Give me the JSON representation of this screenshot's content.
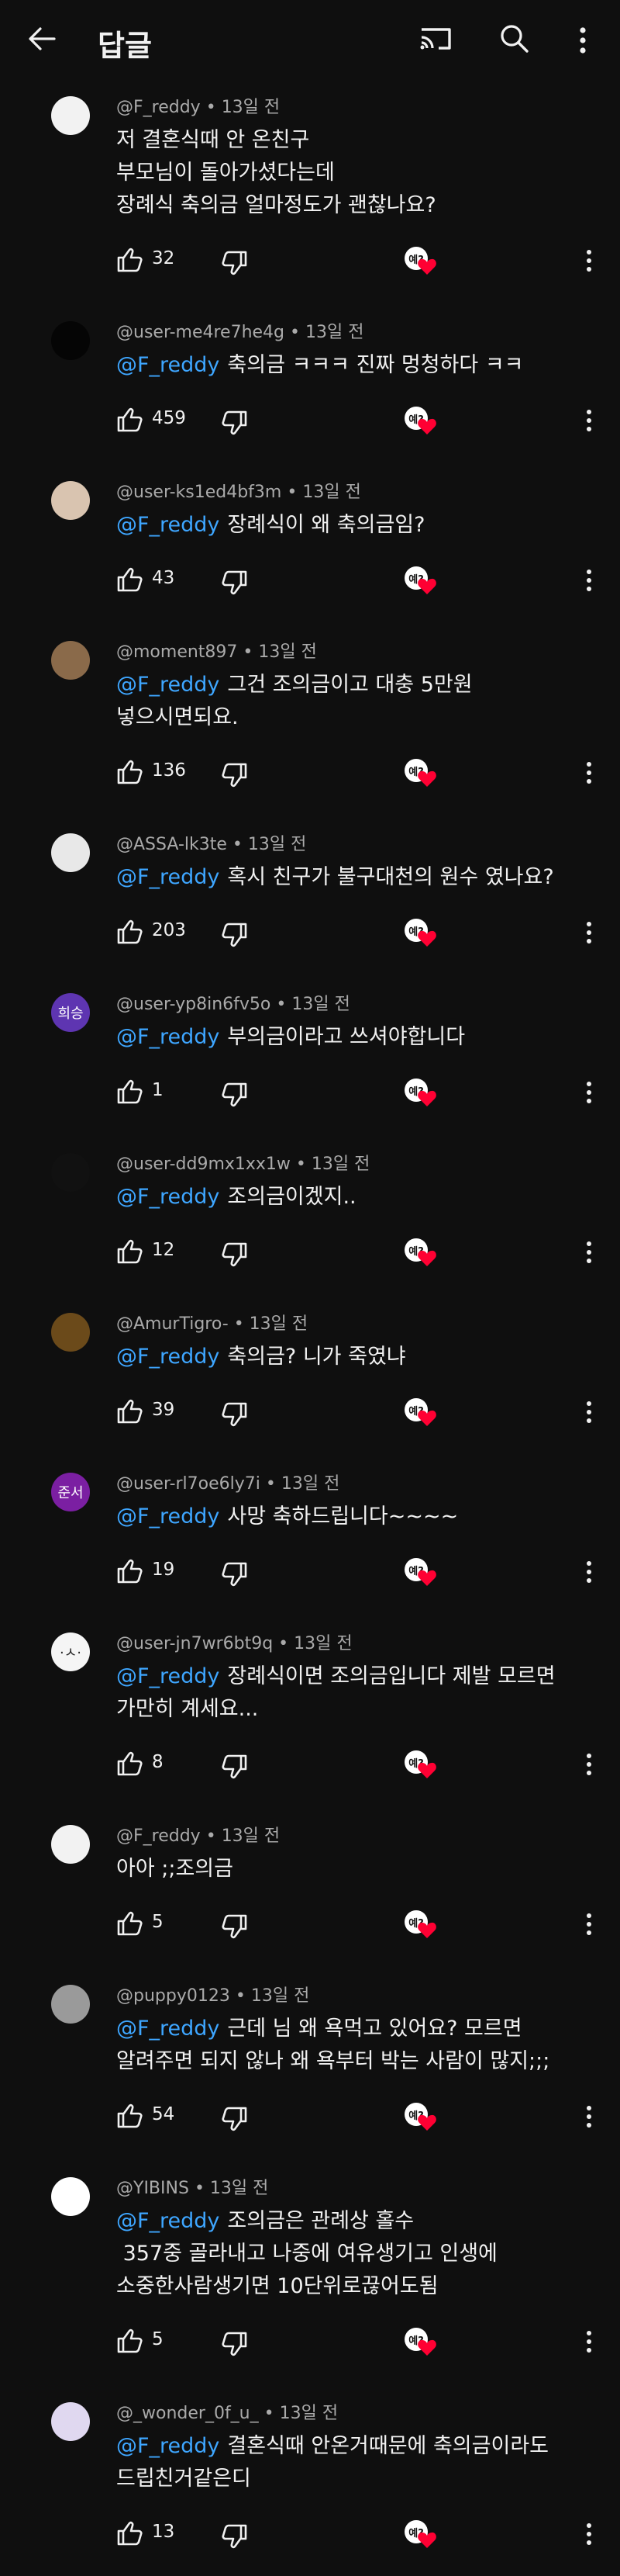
{
  "header": {
    "title": "답글",
    "back_icon": "back-arrow-icon",
    "cast_icon": "cast-icon",
    "search_icon": "search-icon",
    "more_icon": "more-vertical-icon"
  },
  "colors": {
    "background": "#0f0f0f",
    "mention": "#3ea6ff",
    "meta": "#aaaaaa",
    "heart": "#ff0033"
  },
  "comments": [
    {
      "author": "@F_reddy",
      "time": "13일 전",
      "mention": "",
      "text": "저 결혼식때 안 온친구\n부모님이 돌아가셨다는데\n장례식 축의금 얼마정도가 괜찮나요?",
      "likes": "32",
      "avatar_text": "",
      "avatar_color": "#f2f2f2"
    },
    {
      "author": "@user-me4re7he4g",
      "time": "13일 전",
      "mention": "@F_reddy",
      "text": "축의금 ㅋㅋㅋ 진짜 멍청하다 ㅋㅋ",
      "likes": "459",
      "avatar_text": "",
      "avatar_color": "#050505"
    },
    {
      "author": "@user-ks1ed4bf3m",
      "time": "13일 전",
      "mention": "@F_reddy",
      "text": "장례식이 왜 축의금임?",
      "likes": "43",
      "avatar_text": "",
      "avatar_color": "#d9c4b0"
    },
    {
      "author": "@moment897",
      "time": "13일 전",
      "mention": "@F_reddy",
      "text": "그건 조의금이고 대충 5만원\n넣으시면되요.",
      "likes": "136",
      "avatar_text": "",
      "avatar_color": "#8a6a4a"
    },
    {
      "author": "@ASSA-lk3te",
      "time": "13일 전",
      "mention": "@F_reddy",
      "text": "혹시 친구가 불구대천의 원수 였나요?",
      "likes": "203",
      "avatar_text": "",
      "avatar_color": "#e8e8e8"
    },
    {
      "author": "@user-yp8in6fv5o",
      "time": "13일 전",
      "mention": "@F_reddy",
      "text": "부의금이라고 쓰셔야합니다",
      "likes": "1",
      "avatar_text": "희승",
      "avatar_color": "#5e35b1"
    },
    {
      "author": "@user-dd9mx1xx1w",
      "time": "13일 전",
      "mention": "@F_reddy",
      "text": "조의금이겠지..",
      "likes": "12",
      "avatar_text": "",
      "avatar_color": "#111111"
    },
    {
      "author": "@AmurTigro-",
      "time": "13일 전",
      "mention": "@F_reddy",
      "text": "축의금? 니가 죽였냐",
      "likes": "39",
      "avatar_text": "",
      "avatar_color": "#6b4a1a"
    },
    {
      "author": "@user-rl7oe6ly7i",
      "time": "13일 전",
      "mention": "@F_reddy",
      "text": "사망 축하드립니다~~~~",
      "likes": "19",
      "avatar_text": "준서",
      "avatar_color": "#7b1fa2"
    },
    {
      "author": "@user-jn7wr6bt9q",
      "time": "13일 전",
      "mention": "@F_reddy",
      "text": "장례식이면 조의금입니다 제발 모르면\n가만히 계세요...",
      "likes": "8",
      "avatar_text": "·ㅅ·",
      "avatar_color": "#f5f5f5"
    },
    {
      "author": "@F_reddy",
      "time": "13일 전",
      "mention": "",
      "text": "아아 ;;조의금",
      "likes": "5",
      "avatar_text": "",
      "avatar_color": "#f2f2f2"
    },
    {
      "author": "@puppy0123",
      "time": "13일 전",
      "mention": "@F_reddy",
      "text": "근데 님 왜 욕먹고 있어요? 모르면\n알려주면 되지 않나 왜 욕부터 박는 사람이 많지;;;",
      "likes": "54",
      "avatar_text": "",
      "avatar_color": "#9a9a9a"
    },
    {
      "author": "@YIBINS",
      "time": "13일 전",
      "mention": "@F_reddy",
      "text": "조의금은 관례상 홀수\n 357중 골라내고 나중에 여유생기고 인생에\n소중한사람생기면 10단위로끊어도됨",
      "likes": "5",
      "avatar_text": "",
      "avatar_color": "#ffffff"
    },
    {
      "author": "@_wonder_0f_u_",
      "time": "13일 전",
      "mention": "@F_reddy",
      "text": "결혼식때 안온거때문에 축의금이라도\n드립친거같은디",
      "likes": "13",
      "avatar_text": "",
      "avatar_color": "#e0d8f0"
    }
  ]
}
